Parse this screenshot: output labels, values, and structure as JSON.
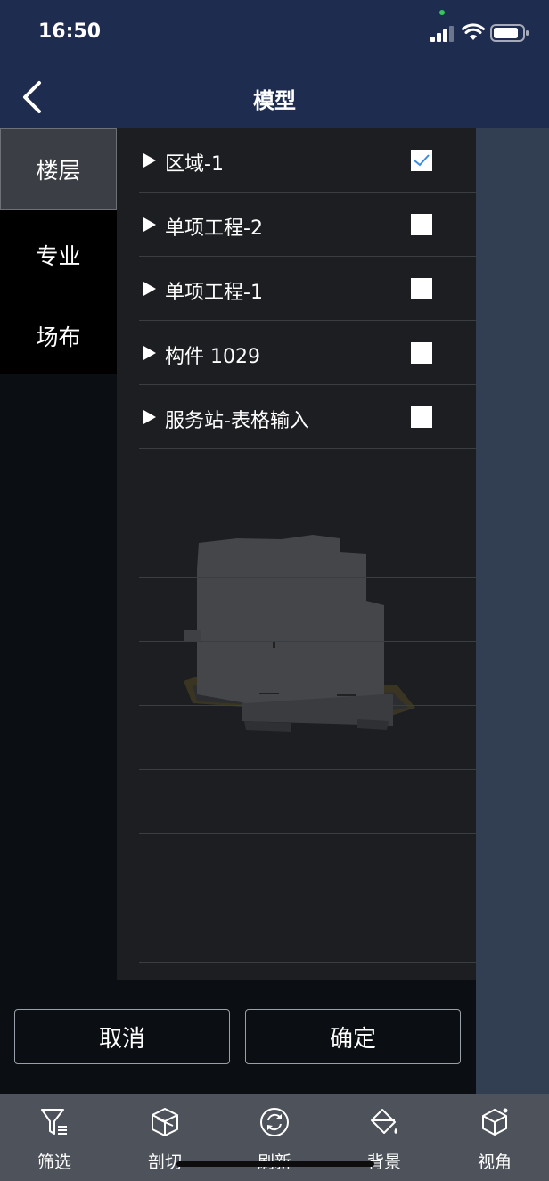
{
  "status_bar": {
    "time": "16:50"
  },
  "nav": {
    "title": "模型"
  },
  "side_tabs": [
    {
      "label": "楼层",
      "active": true
    },
    {
      "label": "专业",
      "active": false
    },
    {
      "label": "场布",
      "active": false
    }
  ],
  "items": [
    {
      "label": "区域-1",
      "checked": true
    },
    {
      "label": "单项工程-2",
      "checked": false
    },
    {
      "label": "单项工程-1",
      "checked": false
    },
    {
      "label": "构件 1029",
      "checked": false
    },
    {
      "label": "服务站-表格输入",
      "checked": false
    }
  ],
  "buttons": {
    "cancel": "取消",
    "confirm": "确定"
  },
  "toolbar": [
    {
      "label": "筛选",
      "icon": "filter-icon"
    },
    {
      "label": "剖切",
      "icon": "section-cut-icon"
    },
    {
      "label": "刷新",
      "icon": "refresh-icon"
    },
    {
      "label": "背景",
      "icon": "paint-bucket-icon"
    },
    {
      "label": "视角",
      "icon": "cube-view-icon"
    }
  ],
  "colors": {
    "header": "#1e2d4f",
    "list_background": "#1c1e22",
    "toolbar": "#4e525a",
    "checkmark": "#3a8de0"
  }
}
